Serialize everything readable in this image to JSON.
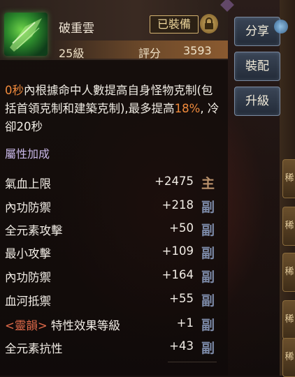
{
  "item": {
    "name": "破重雲",
    "level": "25級",
    "score_label": "評分",
    "score_value": "3593",
    "equipped_badge": "已裝備"
  },
  "description": {
    "seg1": "0秒",
    "seg2": "內根據命中人數提高自身怪物克制(包括首領克制和建築克制),最多提高",
    "seg3": "18%",
    "seg4": ", 冷卻20秒"
  },
  "attributes_title": "屬性加成",
  "attributes": [
    {
      "name": "氣血上限",
      "value": "+2475",
      "tag": "主"
    },
    {
      "name": "內功防禦",
      "value": "+218",
      "tag": "副"
    },
    {
      "name": "全元素攻擊",
      "value": "+50",
      "tag": "副"
    },
    {
      "name": "最小攻擊",
      "value": "+109",
      "tag": "副"
    },
    {
      "name": "內功防禦",
      "value": "+164",
      "tag": "副"
    },
    {
      "name": "血河抵禦",
      "value": "+55",
      "tag": "副"
    },
    {
      "name": "特性效果等級",
      "prefix": "<靈韻>",
      "value": "+1",
      "tag": "副"
    },
    {
      "name": "全元素抗性",
      "value": "+43",
      "tag": "副"
    }
  ],
  "buttons": {
    "share": "分享",
    "equip": "裝配",
    "upgrade": "升級"
  },
  "right_strip_label": "稀",
  "colors": {
    "highlight": "#f08a3c",
    "section_title": "#c9b8e8",
    "spirit_prefix": "#e06a4a"
  }
}
